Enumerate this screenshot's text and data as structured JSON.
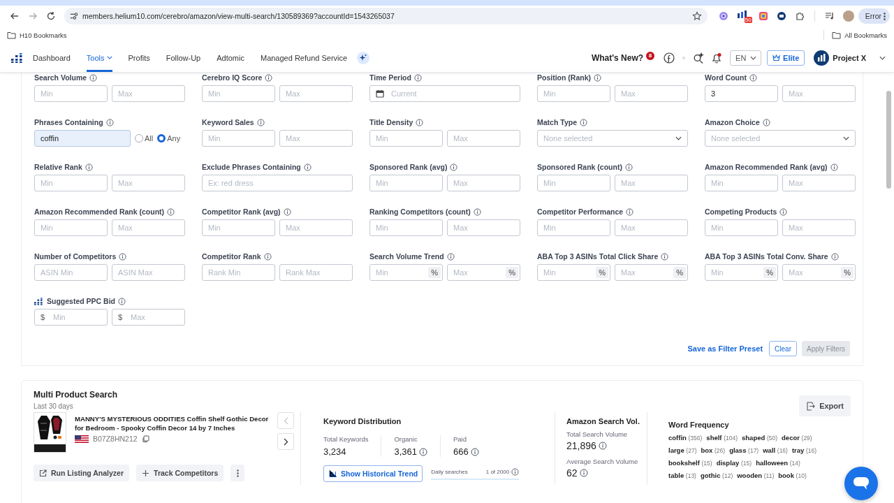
{
  "browser": {
    "url": "members.helium10.com/cerebro/amazon/view-multi-search/130589369?accountId=1543265037",
    "extension_badge": "50",
    "profile_label": "Error",
    "bookmarks_folder": "H10 Bookmarks",
    "all_bookmarks": "All Bookmarks"
  },
  "nav": {
    "items": [
      {
        "label": "Dashboard",
        "selected": false,
        "dropdown": false
      },
      {
        "label": "Tools",
        "selected": true,
        "dropdown": true
      },
      {
        "label": "Profits",
        "selected": false,
        "dropdown": false
      },
      {
        "label": "Follow-Up",
        "selected": false,
        "dropdown": false
      },
      {
        "label": "Adtomic",
        "selected": false,
        "dropdown": false
      },
      {
        "label": "Managed Refund Service",
        "selected": false,
        "dropdown": false
      }
    ],
    "whats_new": "What's New?",
    "whats_new_badge": "8",
    "language": "EN",
    "plan": "Elite",
    "account": "Project X"
  },
  "filters": [
    {
      "label": "Search Volume",
      "kind": "range",
      "inputs": [
        {
          "placeholder": "Min"
        },
        {
          "placeholder": "Max"
        }
      ]
    },
    {
      "label": "Cerebro IQ Score",
      "kind": "range",
      "inputs": [
        {
          "placeholder": "Min"
        },
        {
          "placeholder": "Max"
        }
      ]
    },
    {
      "label": "Time Period",
      "kind": "date",
      "placeholder": "Current"
    },
    {
      "label": "Position (Rank)",
      "kind": "range",
      "inputs": [
        {
          "placeholder": "Min"
        },
        {
          "placeholder": "Max"
        }
      ]
    },
    {
      "label": "Word Count",
      "kind": "range",
      "inputs": [
        {
          "value": "3"
        },
        {
          "placeholder": "Max"
        }
      ]
    },
    {
      "label": "Phrases Containing",
      "kind": "phrases",
      "value": "coffin",
      "options": [
        {
          "label": "All",
          "selected": false
        },
        {
          "label": "Any",
          "selected": true
        }
      ]
    },
    {
      "label": "Keyword Sales",
      "kind": "range",
      "inputs": [
        {
          "placeholder": "Min"
        },
        {
          "placeholder": "Max"
        }
      ]
    },
    {
      "label": "Title Density",
      "kind": "range",
      "inputs": [
        {
          "placeholder": "Min"
        },
        {
          "placeholder": "Max"
        }
      ]
    },
    {
      "label": "Match Type",
      "kind": "select",
      "placeholder": "None selected"
    },
    {
      "label": "Amazon Choice",
      "kind": "select",
      "placeholder": "None selected"
    },
    {
      "label": "Relative Rank",
      "kind": "range",
      "inputs": [
        {
          "placeholder": "Min"
        },
        {
          "placeholder": "Max"
        }
      ]
    },
    {
      "label": "Exclude Phrases Containing",
      "kind": "text",
      "placeholder": "Ex: red dress"
    },
    {
      "label": "Sponsored Rank (avg)",
      "kind": "range",
      "inputs": [
        {
          "placeholder": "Min"
        },
        {
          "placeholder": "Max"
        }
      ]
    },
    {
      "label": "Sponsored Rank (count)",
      "kind": "range",
      "inputs": [
        {
          "placeholder": "Min"
        },
        {
          "placeholder": "Max"
        }
      ]
    },
    {
      "label": "Amazon Recommended Rank (avg)",
      "kind": "range",
      "inputs": [
        {
          "placeholder": "Min"
        },
        {
          "placeholder": "Max"
        }
      ]
    },
    {
      "label": "Amazon Recommended Rank (count)",
      "kind": "range",
      "inputs": [
        {
          "placeholder": "Min"
        },
        {
          "placeholder": "Max"
        }
      ]
    },
    {
      "label": "Competitor Rank (avg)",
      "kind": "range",
      "inputs": [
        {
          "placeholder": "Min"
        },
        {
          "placeholder": "Max"
        }
      ]
    },
    {
      "label": "Ranking Competitors (count)",
      "kind": "range",
      "inputs": [
        {
          "placeholder": "Min"
        },
        {
          "placeholder": "Max"
        }
      ]
    },
    {
      "label": "Competitor Performance",
      "kind": "range",
      "inputs": [
        {
          "placeholder": "Min"
        },
        {
          "placeholder": "Max"
        }
      ]
    },
    {
      "label": "Competing Products",
      "kind": "range",
      "inputs": [
        {
          "placeholder": "Min"
        },
        {
          "placeholder": "Max"
        }
      ]
    },
    {
      "label": "Number of Competitors",
      "kind": "range",
      "inputs": [
        {
          "placeholder": "ASIN Min"
        },
        {
          "placeholder": "ASIN Max"
        }
      ]
    },
    {
      "label": "Competitor Rank",
      "kind": "range",
      "inputs": [
        {
          "placeholder": "Rank Min"
        },
        {
          "placeholder": "Rank Max"
        }
      ]
    },
    {
      "label": "Search Volume Trend",
      "kind": "range",
      "inputs": [
        {
          "placeholder": "Min",
          "suffix": "%"
        },
        {
          "placeholder": "Max",
          "suffix": "%"
        }
      ]
    },
    {
      "label": "ABA Top 3 ASINs Total Click Share",
      "kind": "range",
      "inputs": [
        {
          "placeholder": "Min",
          "suffix": "%"
        },
        {
          "placeholder": "Max",
          "suffix": "%"
        }
      ]
    },
    {
      "label": "ABA Top 3 ASINs Total Conv. Share",
      "kind": "range",
      "inputs": [
        {
          "placeholder": "Min",
          "suffix": "%"
        },
        {
          "placeholder": "Max",
          "suffix": "%"
        }
      ]
    },
    {
      "label": "Suggested PPC Bid",
      "kind": "range",
      "branded": true,
      "inputs": [
        {
          "placeholder": "Min",
          "prefix": "$"
        },
        {
          "placeholder": "Max",
          "prefix": "$"
        }
      ]
    }
  ],
  "filter_actions": {
    "save_preset": "Save as Filter Preset",
    "clear": "Clear",
    "apply": "Apply Filters",
    "apply_disabled": true
  },
  "product_search": {
    "title": "Multi Product Search",
    "subtitle": "Last 30 days",
    "export": "Export",
    "product": {
      "title": "MANNY'S MYSTERIOUS ODDITIES Coffin Shelf Gothic Decor for Bedroom - Spooky Coffin Decor 14 by 7 Inches",
      "asin": "B07Z8HN212",
      "prev_disabled": true
    },
    "actions": [
      "Run Listing Analyzer",
      "Track Competitors"
    ],
    "keyword_distribution": {
      "title": "Keyword Distribution",
      "stats": [
        {
          "label": "Total Keywords",
          "value": "3,234",
          "info": false
        },
        {
          "label": "Organic",
          "value": "3,361",
          "info": true
        },
        {
          "label": "Paid",
          "value": "666",
          "info": true
        }
      ],
      "trend_button": "Show Historical Trend",
      "daily_label": "Daily searches",
      "daily_count": "1 of 2000"
    },
    "search_volume": {
      "title": "Amazon Search Vol.",
      "stats": [
        {
          "label": "Total Search Volume",
          "value": "21,896"
        },
        {
          "label": "Average Search Volume",
          "value": "62"
        }
      ]
    },
    "word_frequency": {
      "title": "Word Frequency",
      "rows": [
        [
          {
            "word": "coffin",
            "count": "(356)"
          },
          {
            "word": "shelf",
            "count": "(104)"
          },
          {
            "word": "shaped",
            "count": "(50)"
          },
          {
            "word": "decor",
            "count": "(29)"
          }
        ],
        [
          {
            "word": "large",
            "count": "(27)"
          },
          {
            "word": "box",
            "count": "(26)"
          },
          {
            "word": "glass",
            "count": "(17)"
          },
          {
            "word": "wall",
            "count": "(16)"
          },
          {
            "word": "tray",
            "count": "(16)"
          }
        ],
        [
          {
            "word": "bookshelf",
            "count": "(15)"
          },
          {
            "word": "display",
            "count": "(15)"
          },
          {
            "word": "halloween",
            "count": "(14)"
          }
        ],
        [
          {
            "word": "table",
            "count": "(13)"
          },
          {
            "word": "gothic",
            "count": "(12)"
          },
          {
            "word": "wooden",
            "count": "(11)"
          },
          {
            "word": "book",
            "count": "(10)"
          }
        ]
      ]
    }
  }
}
